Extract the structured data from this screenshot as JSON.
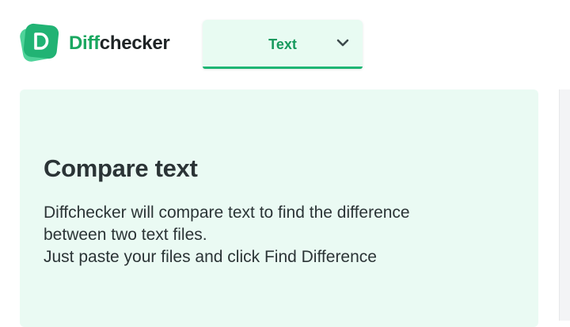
{
  "header": {
    "brand": {
      "part1": "Diff",
      "part2": "checker",
      "mark_letter": "D",
      "mark_color": "#21b374",
      "mark_color_back": "#4fd39a"
    },
    "mode_selector": {
      "selected": "Text",
      "icon": "chevron-down-icon"
    }
  },
  "hero": {
    "title": "Compare text",
    "description_lines": [
      "Diffchecker will compare text to find the difference",
      "between two text files.",
      "Just paste your files and click Find Difference"
    ]
  },
  "colors": {
    "accent": "#1fb574",
    "hero_background": "#eafaf3",
    "text_dark": "#2b3436"
  }
}
